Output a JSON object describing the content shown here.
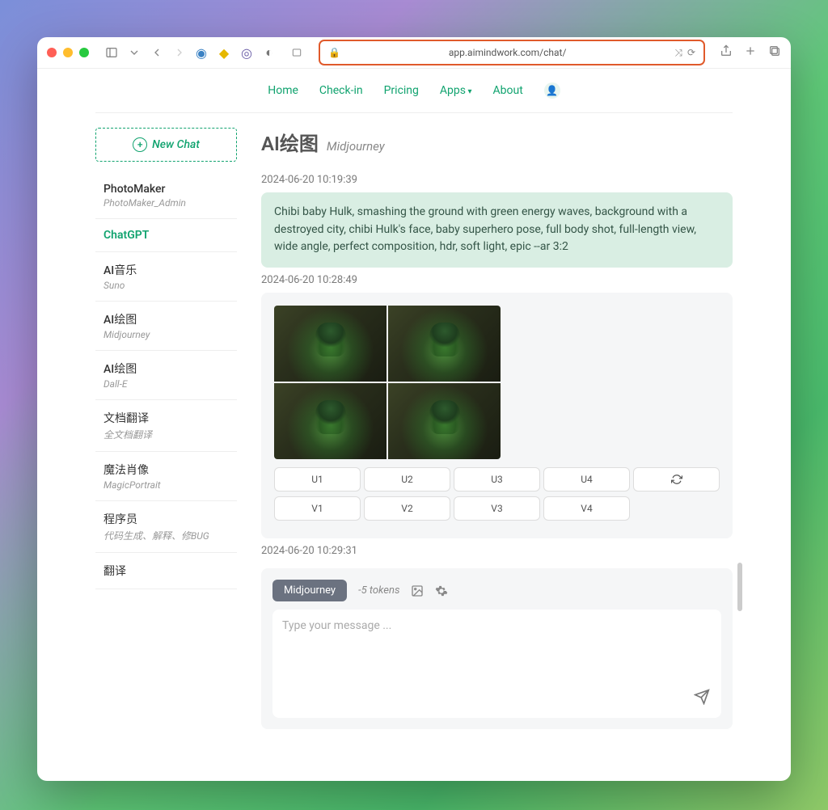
{
  "browser": {
    "url": "app.aimindwork.com/chat/"
  },
  "nav": {
    "items": [
      "Home",
      "Check-in",
      "Pricing",
      "Apps",
      "About"
    ]
  },
  "sidebar": {
    "newchat": "New Chat",
    "items": [
      {
        "title": "PhotoMaker",
        "sub": "PhotoMaker_Admin"
      },
      {
        "title": "ChatGPT",
        "sub": ""
      },
      {
        "title": "AI音乐",
        "sub": "Suno"
      },
      {
        "title": "AI绘图",
        "sub": "Midjourney"
      },
      {
        "title": "AI绘图",
        "sub": "Dall-E"
      },
      {
        "title": "文档翻译",
        "sub": "全文档翻译"
      },
      {
        "title": "魔法肖像",
        "sub": "MagicPortrait"
      },
      {
        "title": "程序员",
        "sub": "代码生成、解释、修BUG"
      },
      {
        "title": "翻译",
        "sub": ""
      }
    ],
    "activeIndex": 1
  },
  "main": {
    "title": "AI绘图",
    "subtitle": "Midjourney",
    "ts1": "2024-06-20 10:19:39",
    "prompt": "Chibi baby Hulk, smashing the ground with green energy waves, background with a destroyed city, chibi Hulk's face, baby superhero pose, full body shot, full-length view, wide angle, perfect composition, hdr, soft light, epic --ar 3:2",
    "ts2": "2024-06-20 10:28:49",
    "u_buttons": [
      "U1",
      "U2",
      "U3",
      "U4"
    ],
    "v_buttons": [
      "V1",
      "V2",
      "V3",
      "V4"
    ],
    "ts3": "2024-06-20 10:29:31"
  },
  "input": {
    "model": "Midjourney",
    "tokens": "-5 tokens",
    "placeholder": "Type your message ..."
  }
}
